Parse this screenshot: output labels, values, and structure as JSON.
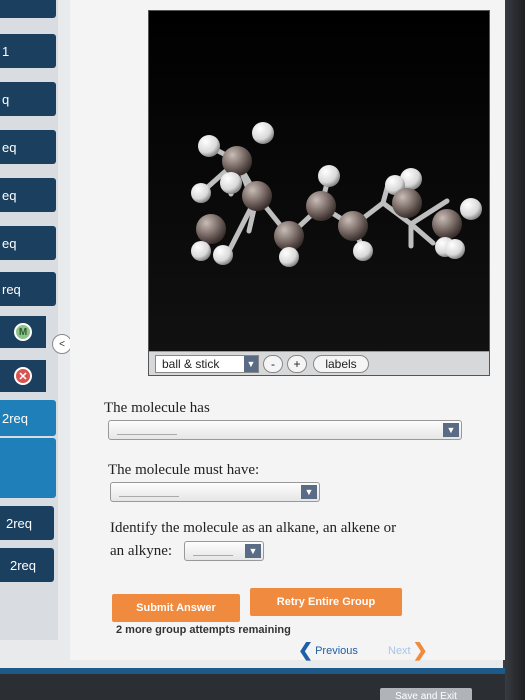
{
  "sidebar": {
    "items": [
      {
        "label": "1"
      },
      {
        "label": "q"
      },
      {
        "label": "eq"
      },
      {
        "label": "eq"
      },
      {
        "label": "eq"
      },
      {
        "label": "req"
      }
    ],
    "badge_m": "M",
    "badge_x": "✕",
    "parts": [
      {
        "label": "2req"
      },
      {
        "label": "2req"
      },
      {
        "label": "2req"
      }
    ],
    "collapse_glyph": "<"
  },
  "viewer": {
    "mode_select": "ball & stick",
    "minus": "-",
    "plus": "+",
    "labels_button": "labels"
  },
  "questions": {
    "q1": "The molecule has",
    "q2": "The molecule must have:",
    "q3_line1": "Identify the molecule as an alkane, an alkene or",
    "q3_line2": "an alkyne:"
  },
  "actions": {
    "submit": "Submit Answer",
    "retry": "Retry Entire Group",
    "attempts": "2 more group attempts remaining",
    "previous": "Previous",
    "next": "Next",
    "save_exit": "Save and Exit"
  },
  "colors": {
    "accent": "#1f7fb8",
    "orange": "#f08a3e",
    "link": "#1f5fa8"
  }
}
